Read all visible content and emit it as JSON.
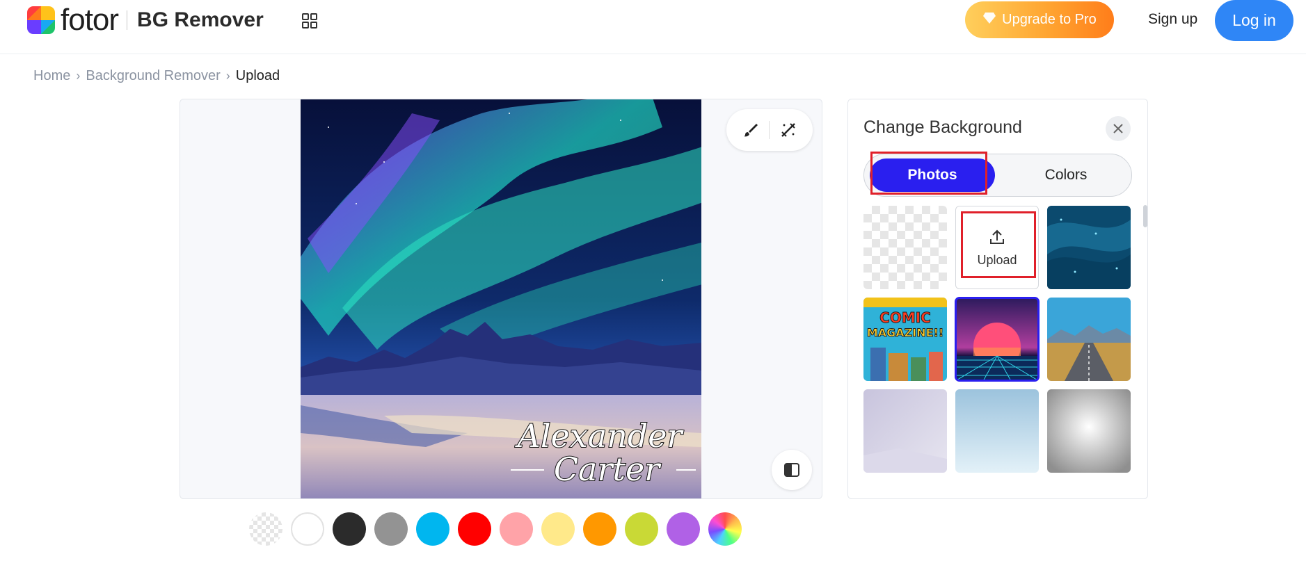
{
  "header": {
    "logo_word": "fotor",
    "product_name": "BG Remover",
    "apps_icon": "grid-apps-icon",
    "upgrade_label": "Upgrade to Pro",
    "signup_label": "Sign up",
    "login_label": "Log in",
    "colors": {
      "upgrade": "#ffa531",
      "login": "#2f86f6"
    }
  },
  "breadcrumb": {
    "items": [
      "Home",
      "Background Remover"
    ],
    "current": "Upload"
  },
  "editor": {
    "image_text_line1": "Alexander",
    "image_text_line2": "Carter",
    "tools": [
      "brush-icon",
      "magic-wand-icon"
    ],
    "compare_icon": "compare-icon"
  },
  "swatches": [
    {
      "name": "transparent",
      "color": "transparent"
    },
    {
      "name": "white",
      "color": "#ffffff"
    },
    {
      "name": "black",
      "color": "#2b2b2b"
    },
    {
      "name": "gray",
      "color": "#939393"
    },
    {
      "name": "sky-blue",
      "color": "#00b6ef"
    },
    {
      "name": "red",
      "color": "#ff0000"
    },
    {
      "name": "pink",
      "color": "#ffa3a8"
    },
    {
      "name": "light-yellow",
      "color": "#ffe98a"
    },
    {
      "name": "orange",
      "color": "#ff9800"
    },
    {
      "name": "lime",
      "color": "#c9d936"
    },
    {
      "name": "purple",
      "color": "#b061e6"
    },
    {
      "name": "rainbow",
      "color": "multicolor"
    }
  ],
  "panel": {
    "title": "Change Background",
    "close_icon": "close-icon",
    "tabs": [
      {
        "label": "Photos",
        "active": true
      },
      {
        "label": "Colors",
        "active": false
      }
    ],
    "tiles": [
      "transparent",
      "upload",
      "blue-sparkle",
      "comic-magazine",
      "retro-sunset",
      "mountain-road",
      "lavender-room",
      "light-blue-gradient",
      "white-gray-radial"
    ],
    "upload_label": "Upload",
    "comic_text_1": "COMIC",
    "comic_text_2": "MAGAZINE!!",
    "accent": "#2a1fef"
  }
}
